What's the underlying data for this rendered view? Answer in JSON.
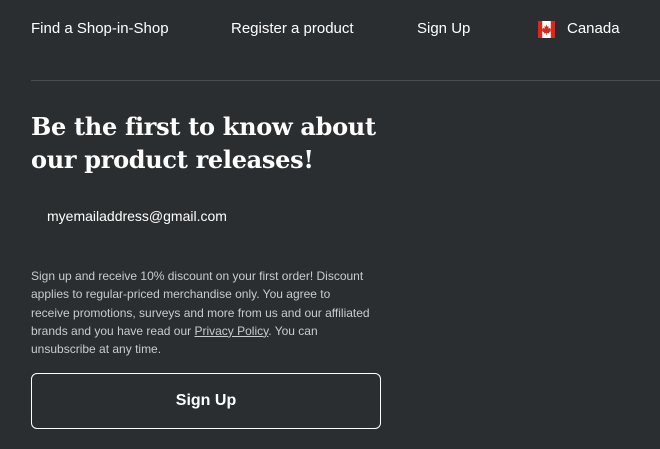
{
  "nav": {
    "find_shop": "Find a Shop-in-Shop",
    "register": "Register a product",
    "signup": "Sign Up",
    "country": {
      "label": "Canada",
      "flag_icon": "canada-flag-icon",
      "flag_colors": {
        "red": "#d52b1e",
        "white": "#ffffff"
      }
    }
  },
  "newsletter": {
    "headline_line1": "Be the first to know about",
    "headline_line2": "our product releases!",
    "email_value": "myemailaddress@gmail.com",
    "disclaimer_before": "Sign up and receive 10% discount on your first order! Discount applies to regular-priced merchandise only. You agree to receive promotions, surveys and more from us and our affiliated brands and you have read our ",
    "privacy_link": "Privacy Policy",
    "disclaimer_after": ". You can unsubscribe at any time.",
    "button_label": "Sign Up"
  },
  "colors": {
    "background": "#2b2e31",
    "text": "#ffffff",
    "muted_text": "#c9cbcd",
    "divider": "#4a4d51"
  }
}
